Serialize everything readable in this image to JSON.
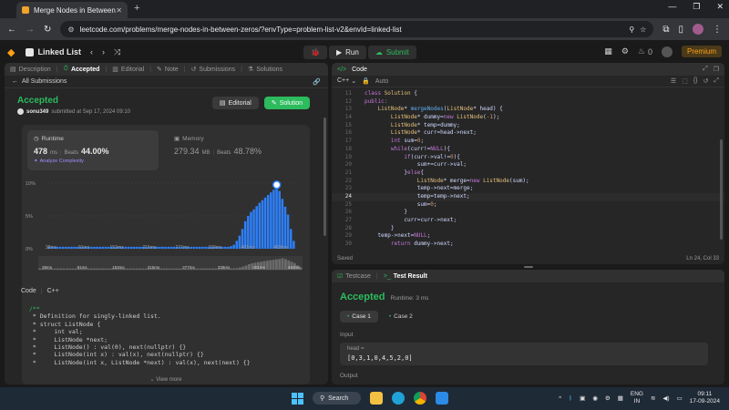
{
  "browser": {
    "tab_title": "Merge Nodes in Between Zeros",
    "url": "leetcode.com/problems/merge-nodes-in-between-zeros/?envType=problem-list-v2&envId=linked-list",
    "new_tab": "+",
    "min": "—",
    "max": "❐",
    "close": "✕"
  },
  "lc_header": {
    "list_name": "Linked List",
    "run_label": "Run",
    "submit_label": "Submit",
    "streak": "0",
    "premium": "Premium"
  },
  "left_tabs": [
    "Description",
    "Accepted",
    "Editorial",
    "Note",
    "Submissions",
    "Solutions"
  ],
  "submission": {
    "back_label": "All Submissions",
    "status": "Accepted",
    "user": "sonu349",
    "submitted_text": "submitted at Sep 17, 2024 09:10",
    "editorial_btn": "Editorial",
    "solution_btn": "Solution",
    "runtime_label": "Runtime",
    "runtime_value": "478",
    "runtime_unit": "ms",
    "runtime_beats_label": "Beats",
    "runtime_beats": "44.00%",
    "analyze": "Analyze Complexity",
    "memory_label": "Memory",
    "memory_value": "279.34",
    "memory_unit": "MB",
    "memory_beats_label": "Beats",
    "memory_beats": "48.78%"
  },
  "chart_data": {
    "type": "bar",
    "y_ticks": [
      "10%",
      "5%",
      "0%"
    ],
    "x_ticks": [
      "38ms",
      "91ms",
      "153ms",
      "215ms",
      "277ms",
      "339ms",
      "401ms",
      "463ms"
    ],
    "ylim": [
      0,
      10
    ],
    "values": [
      0.3,
      0.3,
      0.3,
      0.3,
      0.3,
      0.3,
      0.3,
      0.3,
      0.3,
      0.3,
      0.3,
      0.3,
      0.3,
      0.3,
      0.3,
      0.3,
      0.3,
      0.3,
      0.3,
      0.3,
      0.3,
      0.3,
      0.3,
      0.3,
      0.3,
      0.3,
      0.3,
      0.3,
      0.3,
      0.3,
      0.3,
      0.3,
      0.3,
      0.3,
      0.3,
      0.3,
      0.3,
      0.3,
      0.3,
      0.3,
      0.3,
      0.3,
      0.3,
      0.3,
      0.3,
      0.3,
      0.3,
      0.3,
      0.3,
      0.3,
      0.3,
      0.3,
      0.3,
      0.3,
      0.3,
      0.3,
      0.3,
      0.3,
      0.3,
      0.3,
      0.3,
      0.3,
      0.3,
      0.3,
      0.4,
      0.6,
      1.2,
      2.0,
      3.0,
      4.2,
      5.0,
      5.6,
      6.0,
      6.5,
      7.0,
      7.4,
      7.8,
      8.2,
      8.6,
      9.0,
      9.6,
      8.8,
      7.6,
      6.4,
      5.2,
      3.0,
      1.2
    ],
    "highlight_index": 80,
    "color": "#2d7ff9",
    "muted_color": "#3b4a66"
  },
  "mini_ticks": [
    "38ms",
    "91ms",
    "153ms",
    "215ms",
    "277ms",
    "339ms",
    "401ms",
    "463ms"
  ],
  "code_preview": {
    "header": "Code",
    "lang": "C++",
    "lines": [
      "/**",
      " * Definition for singly-linked list.",
      " * struct ListNode {",
      " *     int val;",
      " *     ListNode *next;",
      " *     ListNode() : val(0), next(nullptr) {}",
      " *     ListNode(int x) : val(x), next(nullptr) {}",
      " *     ListNode(int x, ListNode *next) : val(x), next(next) {}"
    ],
    "view_more": "View more"
  },
  "editor": {
    "tab": "Code",
    "lang": "C++",
    "mode": "Auto",
    "start_line": 11,
    "saved": "Saved",
    "position": "Ln 24, Col 33"
  },
  "result": {
    "testcase_tab": "Testcase",
    "result_tab": "Test Result",
    "status": "Accepted",
    "runtime": "Runtime: 3 ms",
    "case1": "Case 1",
    "case2": "Case 2",
    "input_label": "Input",
    "var": "head =",
    "value": "[0,3,1,0,4,5,2,0]",
    "output_label": "Output"
  },
  "taskbar": {
    "search": "Search",
    "lang1": "ENG",
    "lang2": "IN",
    "time": "09:11",
    "date": "17-09-2024"
  }
}
